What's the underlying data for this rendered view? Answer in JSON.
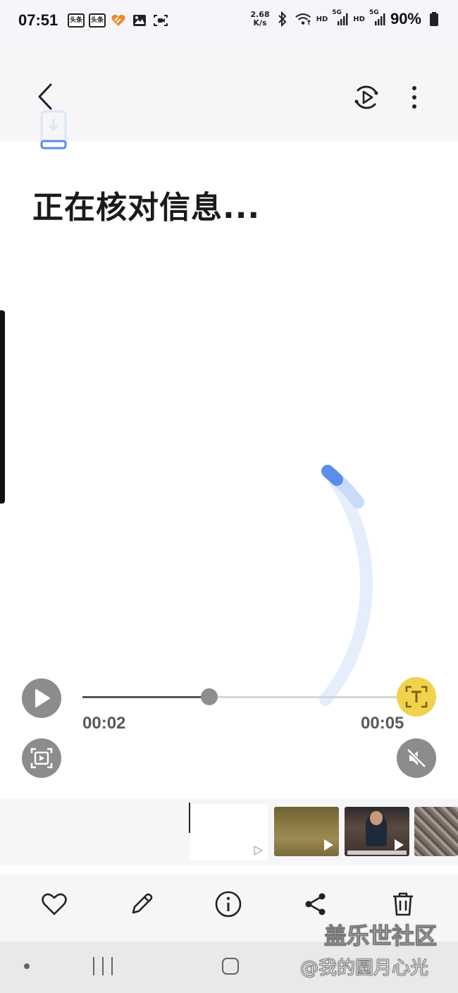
{
  "status_bar": {
    "time": "07:51",
    "app_badge_1": "头条",
    "app_badge_2": "头条",
    "net_speed_value": "2.68",
    "net_speed_unit": "K/s",
    "hd_1": "HD",
    "signal_1": "5G",
    "hd_2": "HD",
    "signal_2": "5G",
    "battery": "90%"
  },
  "header": {
    "icons": [
      "back-arrow-icon",
      "motion-photo-play-icon",
      "more-vertical-icon"
    ]
  },
  "main": {
    "headline": "正在核对信息..."
  },
  "player": {
    "current_time": "00:02",
    "total_time": "00:05",
    "progress_fraction": 0.4,
    "accent_color": "#f1d24d",
    "spinner_color": "#5b8ee8"
  },
  "filmstrip": {
    "thumbnails": [
      "video-thumbnail-landscape",
      "video-thumbnail-person",
      "video-thumbnail-crowd"
    ]
  },
  "action_bar": {
    "icons": [
      "heart-icon",
      "edit-pencil-icon",
      "info-icon",
      "share-icon",
      "trash-icon"
    ]
  },
  "watermark": {
    "line1": "盖乐世社区",
    "line2": "@我的圆月心光"
  }
}
